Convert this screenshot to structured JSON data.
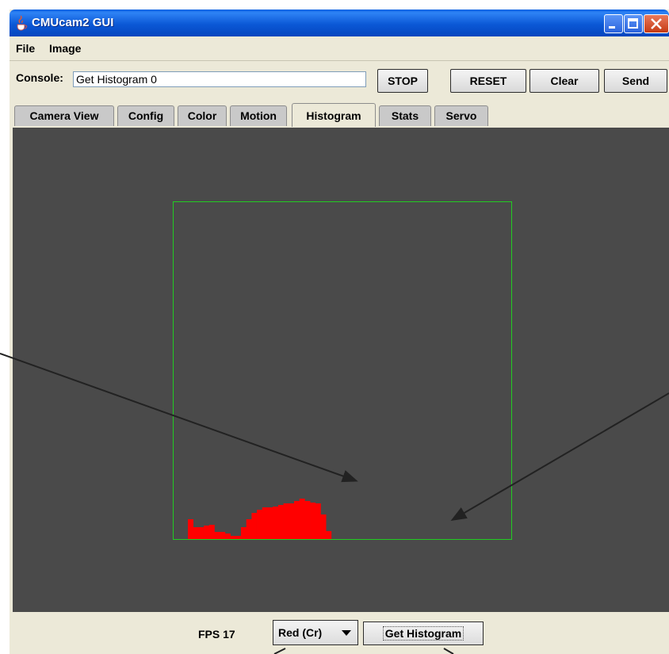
{
  "window": {
    "title": "CMUcam2 GUI",
    "icon": "java-cup-icon"
  },
  "menu": {
    "items": [
      {
        "label": "File"
      },
      {
        "label": "Image"
      }
    ]
  },
  "console": {
    "label": "Console:",
    "value": "Get Histogram 0",
    "buttons": {
      "stop": "STOP",
      "reset": "RESET",
      "clear": "Clear",
      "send": "Send"
    }
  },
  "tabs": [
    {
      "label": "Camera View"
    },
    {
      "label": "Config"
    },
    {
      "label": "Color"
    },
    {
      "label": "Motion"
    },
    {
      "label": "Histogram",
      "active": true
    },
    {
      "label": "Stats"
    },
    {
      "label": "Servo"
    }
  ],
  "histogram": {
    "bar_color": "#ff0000",
    "frame_color": "#22cc22",
    "background": "#4a4a4a",
    "bins": [
      0,
      0,
      0,
      0,
      0,
      0,
      0,
      0,
      0,
      0,
      0,
      0,
      0,
      0,
      0,
      0,
      0,
      0,
      0,
      0,
      0,
      0,
      0,
      0,
      0,
      0,
      0,
      0,
      0,
      0,
      0,
      0,
      0,
      0,
      0,
      0,
      0,
      0,
      0,
      0,
      0,
      0,
      0,
      0,
      0,
      0,
      0,
      0,
      0,
      0,
      0,
      0,
      0,
      0,
      0,
      0,
      0,
      0,
      0,
      0,
      0,
      0,
      0,
      0
    ],
    "values": [
      0,
      0,
      0,
      0,
      0,
      0,
      0,
      0,
      0,
      0,
      0,
      0,
      0,
      0,
      0,
      0,
      0,
      0,
      0,
      0,
      0,
      0,
      0,
      0,
      0,
      0,
      0,
      0,
      0,
      0,
      0,
      0,
      0,
      0,
      0,
      0,
      0,
      0,
      0,
      0,
      0,
      0,
      0,
      0,
      0,
      0,
      0,
      0,
      0,
      0,
      0,
      0,
      0,
      0,
      0,
      0,
      0,
      0,
      0,
      0,
      0,
      0,
      0,
      0
    ],
    "levels": [
      25,
      15,
      15,
      17,
      18,
      9,
      9,
      7,
      4,
      4,
      15,
      25,
      33,
      37,
      40,
      40,
      41,
      43,
      45,
      45,
      48,
      51,
      48,
      46,
      45,
      31,
      10,
      0,
      0,
      0,
      0,
      0,
      0,
      0,
      0,
      0,
      0,
      0,
      0,
      0,
      0,
      0,
      0,
      0,
      0,
      0,
      0,
      0,
      0,
      0,
      0,
      0,
      0,
      0,
      0,
      0,
      0,
      0,
      0,
      0,
      0,
      0,
      0,
      0
    ]
  },
  "bottom": {
    "fps_label": "FPS",
    "fps_value": "17",
    "channel_selected": "Red (Cr)",
    "get_histogram_label": "Get Histogram"
  }
}
